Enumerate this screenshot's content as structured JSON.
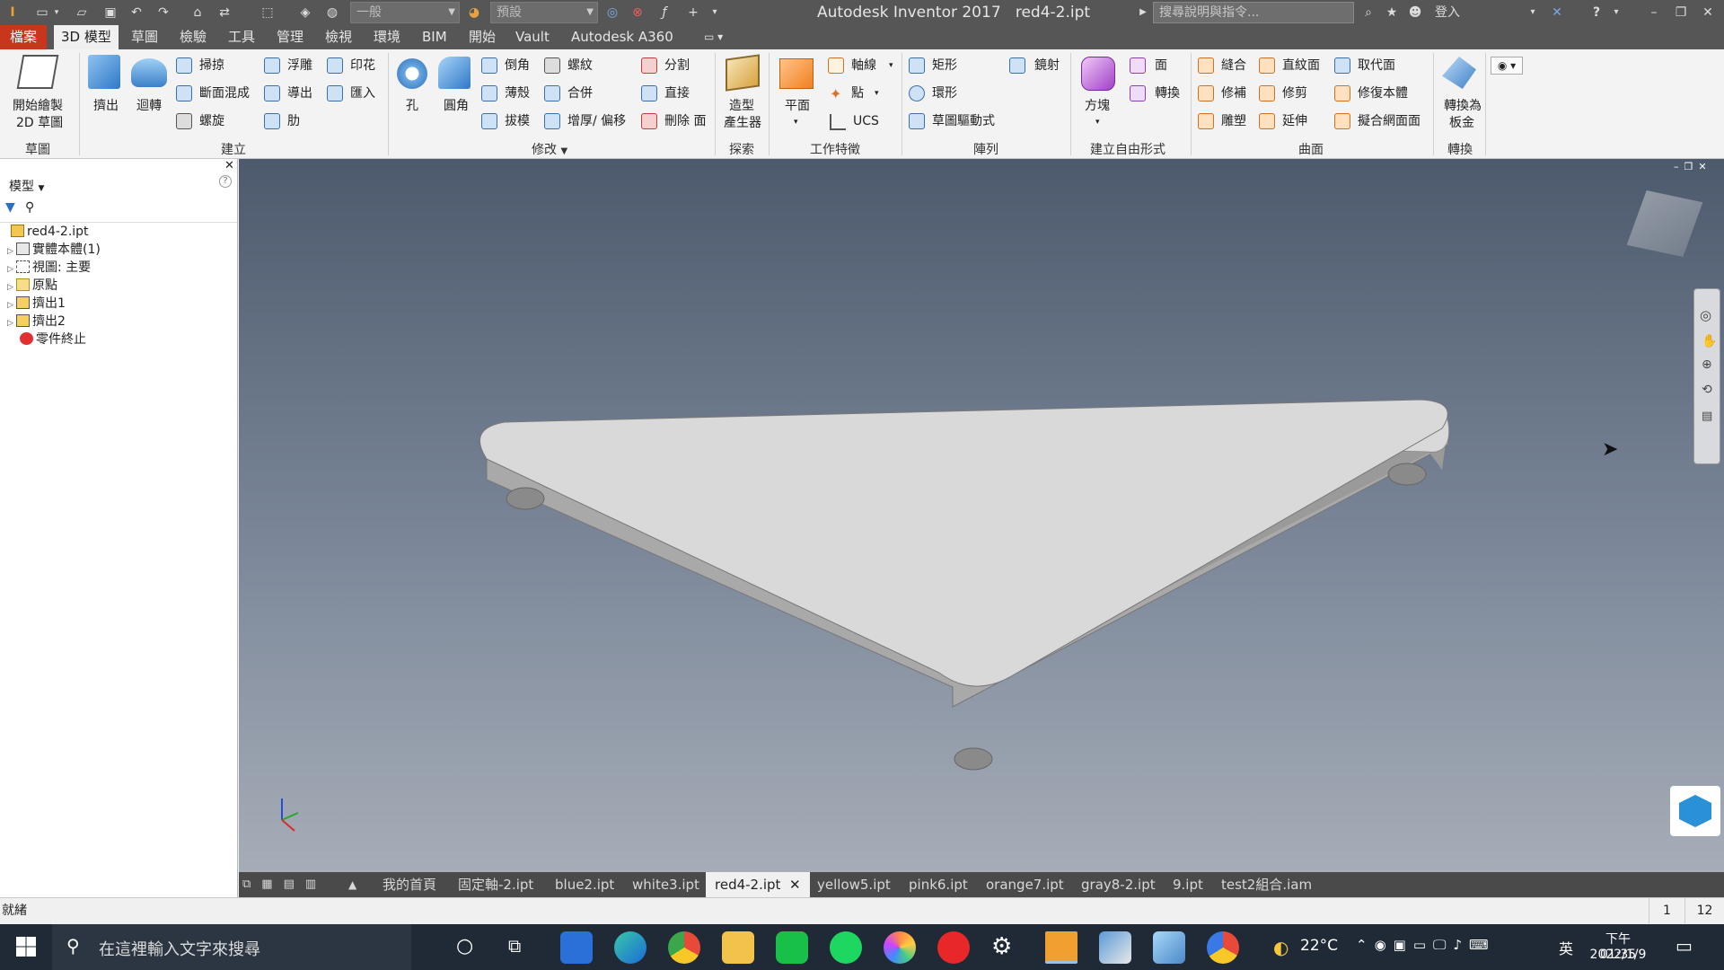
{
  "titlebar": {
    "style_combo": "一般",
    "appearance_combo": "預設",
    "app_name": "Autodesk Inventor 2017",
    "document": "red4-2.ipt",
    "help_search_placeholder": "搜尋說明與指令...",
    "sign_in": "登入"
  },
  "tabs": [
    "檔案",
    "3D 模型",
    "草圖",
    "檢驗",
    "工具",
    "管理",
    "檢視",
    "環境",
    "BIM",
    "開始",
    "Vault",
    "Autodesk A360"
  ],
  "ribbon": {
    "sketch": {
      "start_2d_sketch_line1": "開始繪製",
      "start_2d_sketch_line2": "2D 草圖",
      "group": "草圖"
    },
    "create": {
      "extrude": "擠出",
      "revolve": "迴轉",
      "sweep": "掃掠",
      "loft": "斷面混成",
      "coil": "螺旋",
      "emboss": "浮雕",
      "derive": "導出",
      "rib": "肋",
      "decal": "印花",
      "import": "匯入",
      "group": "建立"
    },
    "modify": {
      "hole": "孔",
      "fillet": "圓角",
      "chamfer": "倒角",
      "shell": "薄殼",
      "draft": "拔模",
      "thread": "螺紋",
      "combine": "合併",
      "thicken": "增厚/ 偏移",
      "split": "分割",
      "direct": "直接",
      "delete_face": "刪除 面",
      "group": "修改"
    },
    "explore": {
      "shape_generator_line1": "造型",
      "shape_generator_line2": "產生器",
      "group": "探索"
    },
    "work_features": {
      "plane": "平面",
      "axis": "軸線",
      "point": "點",
      "ucs": "UCS",
      "group": "工作特徵"
    },
    "pattern": {
      "rectangular": "矩形",
      "circular": "環形",
      "sketch_driven": "草圖驅動式",
      "mirror": "鏡射",
      "group": "陣列"
    },
    "freeform": {
      "box": "方塊",
      "face": "面",
      "convert": "轉換",
      "group": "建立自由形式"
    },
    "surface": {
      "stitch": "縫合",
      "patch": "修補",
      "sculpt": "雕塑",
      "ruled": "直紋面",
      "trim": "修剪",
      "extend": "延伸",
      "replace_face": "取代面",
      "repair_bodies": "修復本體",
      "fit_mesh_face": "擬合網面面",
      "group": "曲面"
    },
    "convert": {
      "to_sheet_metal_line1": "轉換為",
      "to_sheet_metal_line2": "板金",
      "group": "轉換"
    }
  },
  "browser": {
    "title": "模型",
    "tree": [
      {
        "label": "red4-2.ipt",
        "icon": "part-icon",
        "expandable": false
      },
      {
        "label": "實體本體(1)",
        "icon": "solid-bodies-icon",
        "expandable": true
      },
      {
        "label": "視圖: 主要",
        "icon": "view-icon",
        "expandable": true
      },
      {
        "label": "原點",
        "icon": "folder-icon",
        "expandable": true
      },
      {
        "label": "擠出1",
        "icon": "extrude-feature-icon",
        "expandable": true
      },
      {
        "label": "擠出2",
        "icon": "extrude-feature-icon",
        "expandable": true
      },
      {
        "label": "零件終止",
        "icon": "end-of-part-icon",
        "expandable": false
      }
    ]
  },
  "doc_tabs": [
    "我的首頁",
    "固定軸-2.ipt",
    "blue2.ipt",
    "white3.ipt",
    "red4-2.ipt",
    "yellow5.ipt",
    "pink6.ipt",
    "orange7.ipt",
    "gray8-2.ipt",
    "9.ipt",
    "test2組合.iam"
  ],
  "active_doc_tab": "red4-2.ipt",
  "status": {
    "text": "就緒",
    "num1": "1",
    "num2": "12"
  },
  "taskbar": {
    "search_placeholder": "在這裡輸入文字來搜尋",
    "weather": "22°C",
    "ime": "英",
    "time": "下午 01:35",
    "date": "2022/1/9"
  },
  "colors": {
    "file_tab": "#c8361e",
    "title_bg": "#565656",
    "part_face": "#d9d9d9",
    "part_side": "#a9a9a9"
  }
}
